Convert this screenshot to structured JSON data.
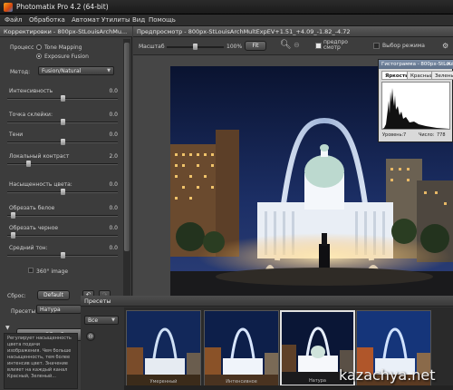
{
  "window": {
    "title": "Photomatix Pro 4.2 (64-bit)"
  },
  "menu": [
    "Файл",
    "Обработка",
    "Автомат",
    "Утилиты",
    "Вид",
    "Помощь"
  ],
  "left_panel": {
    "header": "Корректировки - 800px-StLouisArchMu...",
    "process_label": "Процесс",
    "process_options": [
      {
        "label": "Tone Mapping",
        "selected": false
      },
      {
        "label": "Exposure Fusion",
        "selected": true
      }
    ],
    "method_label": "Метод:",
    "method_value": "Fusion/Natural",
    "sliders": [
      {
        "label": "Интенсивность",
        "value": "0.0",
        "level": 0.5
      },
      {
        "label": "Точка склейки:",
        "value": "0.0",
        "level": 0.5
      },
      {
        "label": "Тени",
        "value": "0.0",
        "level": 0.5
      },
      {
        "label": "Локальный контраст",
        "value": "2.0",
        "level": 0.18
      },
      {
        "label": "Насыщенность цвета:",
        "value": "0.0",
        "level": 0.5
      },
      {
        "label": "Обрезать белое",
        "value": "0.0",
        "level": 0.03
      },
      {
        "label": "Обрезать черное",
        "value": "0.0",
        "level": 0.03
      },
      {
        "label": "Средний тон:",
        "value": "0.0",
        "level": 0.5
      }
    ],
    "image_360_label": "360° image",
    "reset_label": "Сброс:",
    "reset_button": "Default",
    "presets_label": "Пресеты",
    "presets_value": "Натура",
    "process_button": "Обработка",
    "help_text": "Регулирует насыщенность цвета подачи изображения. Чем больше насыщенность, тем более интенсив цвет. Значение влияет на каждый канал Красный, Зеленый..."
  },
  "preview": {
    "header": "Предпросмотр - 800px-StLouisArchMultExpEV+1.51_+4.09_-1.82_-4.72",
    "size_label": "Масштаб",
    "zoom_percent": "100%",
    "fit_button": "Fit",
    "preview_check_label": "предпро смотр",
    "mode_check_label": "Выбор режима"
  },
  "histogram": {
    "title": "Гистограмма - 800px-StLouisArchMultExpEV+1.51",
    "tabs": [
      "Яркость",
      "Красный",
      "Зеленый"
    ],
    "active_tab": "Яркость",
    "level_label": "Уровень:",
    "level_value": "7",
    "count_label": "Число:",
    "count_value": "778"
  },
  "presets_panel": {
    "header": "Пресеты",
    "filter_value": "Все",
    "items": [
      {
        "label": "Умеренный",
        "selected": false
      },
      {
        "label": "Интенсивное",
        "selected": false
      },
      {
        "label": "Натура",
        "selected": true
      },
      {
        "label": "",
        "selected": false
      }
    ]
  },
  "watermark": "kazachya.net"
}
